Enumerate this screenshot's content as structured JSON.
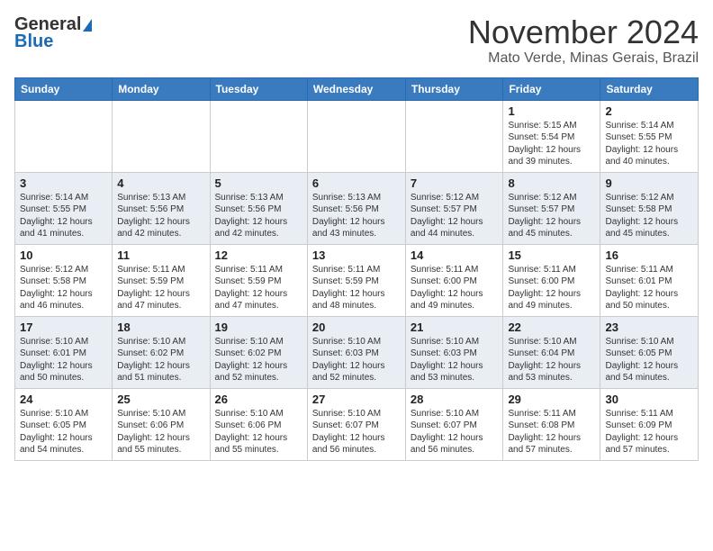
{
  "header": {
    "logo_line1": "General",
    "logo_line2": "Blue",
    "month": "November 2024",
    "location": "Mato Verde, Minas Gerais, Brazil"
  },
  "weekdays": [
    "Sunday",
    "Monday",
    "Tuesday",
    "Wednesday",
    "Thursday",
    "Friday",
    "Saturday"
  ],
  "weeks": [
    [
      {
        "day": "",
        "info": ""
      },
      {
        "day": "",
        "info": ""
      },
      {
        "day": "",
        "info": ""
      },
      {
        "day": "",
        "info": ""
      },
      {
        "day": "",
        "info": ""
      },
      {
        "day": "1",
        "info": "Sunrise: 5:15 AM\nSunset: 5:54 PM\nDaylight: 12 hours\nand 39 minutes."
      },
      {
        "day": "2",
        "info": "Sunrise: 5:14 AM\nSunset: 5:55 PM\nDaylight: 12 hours\nand 40 minutes."
      }
    ],
    [
      {
        "day": "3",
        "info": "Sunrise: 5:14 AM\nSunset: 5:55 PM\nDaylight: 12 hours\nand 41 minutes."
      },
      {
        "day": "4",
        "info": "Sunrise: 5:13 AM\nSunset: 5:56 PM\nDaylight: 12 hours\nand 42 minutes."
      },
      {
        "day": "5",
        "info": "Sunrise: 5:13 AM\nSunset: 5:56 PM\nDaylight: 12 hours\nand 42 minutes."
      },
      {
        "day": "6",
        "info": "Sunrise: 5:13 AM\nSunset: 5:56 PM\nDaylight: 12 hours\nand 43 minutes."
      },
      {
        "day": "7",
        "info": "Sunrise: 5:12 AM\nSunset: 5:57 PM\nDaylight: 12 hours\nand 44 minutes."
      },
      {
        "day": "8",
        "info": "Sunrise: 5:12 AM\nSunset: 5:57 PM\nDaylight: 12 hours\nand 45 minutes."
      },
      {
        "day": "9",
        "info": "Sunrise: 5:12 AM\nSunset: 5:58 PM\nDaylight: 12 hours\nand 45 minutes."
      }
    ],
    [
      {
        "day": "10",
        "info": "Sunrise: 5:12 AM\nSunset: 5:58 PM\nDaylight: 12 hours\nand 46 minutes."
      },
      {
        "day": "11",
        "info": "Sunrise: 5:11 AM\nSunset: 5:59 PM\nDaylight: 12 hours\nand 47 minutes."
      },
      {
        "day": "12",
        "info": "Sunrise: 5:11 AM\nSunset: 5:59 PM\nDaylight: 12 hours\nand 47 minutes."
      },
      {
        "day": "13",
        "info": "Sunrise: 5:11 AM\nSunset: 5:59 PM\nDaylight: 12 hours\nand 48 minutes."
      },
      {
        "day": "14",
        "info": "Sunrise: 5:11 AM\nSunset: 6:00 PM\nDaylight: 12 hours\nand 49 minutes."
      },
      {
        "day": "15",
        "info": "Sunrise: 5:11 AM\nSunset: 6:00 PM\nDaylight: 12 hours\nand 49 minutes."
      },
      {
        "day": "16",
        "info": "Sunrise: 5:11 AM\nSunset: 6:01 PM\nDaylight: 12 hours\nand 50 minutes."
      }
    ],
    [
      {
        "day": "17",
        "info": "Sunrise: 5:10 AM\nSunset: 6:01 PM\nDaylight: 12 hours\nand 50 minutes."
      },
      {
        "day": "18",
        "info": "Sunrise: 5:10 AM\nSunset: 6:02 PM\nDaylight: 12 hours\nand 51 minutes."
      },
      {
        "day": "19",
        "info": "Sunrise: 5:10 AM\nSunset: 6:02 PM\nDaylight: 12 hours\nand 52 minutes."
      },
      {
        "day": "20",
        "info": "Sunrise: 5:10 AM\nSunset: 6:03 PM\nDaylight: 12 hours\nand 52 minutes."
      },
      {
        "day": "21",
        "info": "Sunrise: 5:10 AM\nSunset: 6:03 PM\nDaylight: 12 hours\nand 53 minutes."
      },
      {
        "day": "22",
        "info": "Sunrise: 5:10 AM\nSunset: 6:04 PM\nDaylight: 12 hours\nand 53 minutes."
      },
      {
        "day": "23",
        "info": "Sunrise: 5:10 AM\nSunset: 6:05 PM\nDaylight: 12 hours\nand 54 minutes."
      }
    ],
    [
      {
        "day": "24",
        "info": "Sunrise: 5:10 AM\nSunset: 6:05 PM\nDaylight: 12 hours\nand 54 minutes."
      },
      {
        "day": "25",
        "info": "Sunrise: 5:10 AM\nSunset: 6:06 PM\nDaylight: 12 hours\nand 55 minutes."
      },
      {
        "day": "26",
        "info": "Sunrise: 5:10 AM\nSunset: 6:06 PM\nDaylight: 12 hours\nand 55 minutes."
      },
      {
        "day": "27",
        "info": "Sunrise: 5:10 AM\nSunset: 6:07 PM\nDaylight: 12 hours\nand 56 minutes."
      },
      {
        "day": "28",
        "info": "Sunrise: 5:10 AM\nSunset: 6:07 PM\nDaylight: 12 hours\nand 56 minutes."
      },
      {
        "day": "29",
        "info": "Sunrise: 5:11 AM\nSunset: 6:08 PM\nDaylight: 12 hours\nand 57 minutes."
      },
      {
        "day": "30",
        "info": "Sunrise: 5:11 AM\nSunset: 6:09 PM\nDaylight: 12 hours\nand 57 minutes."
      }
    ]
  ]
}
